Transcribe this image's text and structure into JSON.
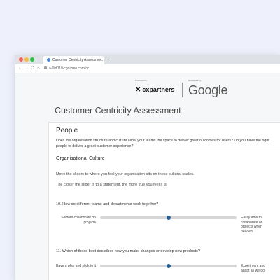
{
  "browser": {
    "tab_title": "Customer Centricity Assessme...",
    "tab_close": "×",
    "new_tab": "+",
    "nav": {
      "back": "←",
      "forward": "→",
      "reload": "C",
      "home": "⌂"
    },
    "url": "a-6fd010-cgoizmo.com/cc"
  },
  "header": {
    "produced_by": "Produced by",
    "developed_by": "Developed by",
    "cx_mark": "✕",
    "cx_name": "cxpartners",
    "google": "Google"
  },
  "page_title": "Customer Centricity Assessment",
  "section": {
    "title": "People",
    "description": "Does the organisation structure and culture allow your teams the space to deliver great outcomes for users? Do you have the right people to deliver a great customer experience?",
    "subsection": "Organisational Culture",
    "instruction1": "Move the sliders to where you feel your organisation sits on these cultural scales.",
    "instruction2": "The closer the slider is to a statement, the more true you feel it is."
  },
  "questions": [
    {
      "label": "10. How do different teams and departments work together?",
      "left": "Seldom collaborate on projects",
      "right": "Easily able to collaborate on projects when needed",
      "value": 0.5
    },
    {
      "label": "11. Which of these best describes how you make changes or develop new products?",
      "left": "Have a plan and stick to it",
      "right": "Experiment and adapt as we go",
      "value": 0.5
    }
  ]
}
